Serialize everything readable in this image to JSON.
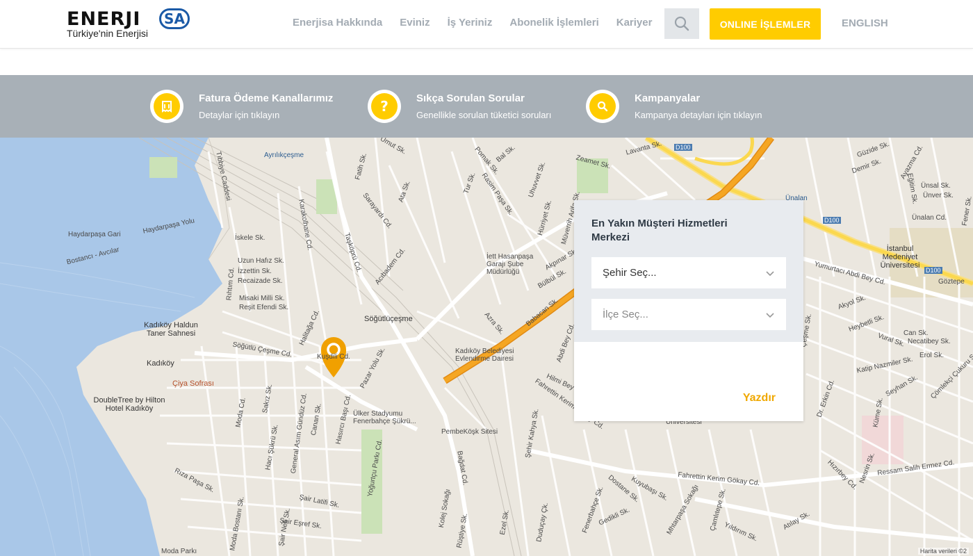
{
  "header": {
    "logo_word": "ENERJI",
    "logo_badge": "SA",
    "logo_tagline": "Türkiye'nin Enerjisi",
    "nav": [
      "Enerjisa Hakkında",
      "Eviniz",
      "İş Yeriniz",
      "Abonelik İşlemleri",
      "Kariyer"
    ],
    "online_label": "ONLINE İŞLEMLER",
    "lang_label": "ENGLISH"
  },
  "band": {
    "items": [
      {
        "icon": "invoice-icon",
        "title": "Fatura Ödeme Kanallarımız",
        "sub": "Detaylar için tıklayın"
      },
      {
        "icon": "question-icon",
        "title": "Sıkça Sorulan Sorular",
        "sub": "Genellikle sorulan tüketici soruları"
      },
      {
        "icon": "search-icon",
        "title": "Kampanyalar",
        "sub": "Kampanya detayları için tıklayın"
      }
    ]
  },
  "panel": {
    "title": "En Yakın Müşteri Hizmetleri Merkezi",
    "city_placeholder": "Şehir Seç...",
    "district_placeholder": "İlçe Seç...",
    "print_label": "Yazdır"
  },
  "map": {
    "labels": [
      "Ayrılıkçeşme",
      "Haydarpaşa Gari",
      "Haydarpaşa Yolu",
      "Bostancı - Avcılar",
      "Tıbbiye Caddesi",
      "İskele Sk.",
      "Uzun Hafız Sk.",
      "İzzettin Sk.",
      "Recaizade Sk.",
      "Misaki Milli Sk.",
      "Reşit Efendi Sk.",
      "Kadıköy Haldun Taner Sahnesi",
      "Kadıköy",
      "Çiya Sofrası",
      "DoubleTree by Hilton Hotel Kadıköy",
      "Söğütlü Çeşme Cd.",
      "Söğütlüçeşme",
      "Sarayardı Cd.",
      "Acıbadem Cd.",
      "Taşköprü Cd.",
      "İett Hasanpaşa Garajı Şube Müdürlüğü",
      "Kadıköy Belediyesi Evlendirme Dairesi",
      "Ülker Stadyumu Fenerbahçe Şükrü...",
      "PembeKöşk Sitesi",
      "Bağdat Cd.",
      "Yoğurtçu Parkı Cd.",
      "Moda Parkı",
      "Zeamet Sk.",
      "Lavanta Sk.",
      "Ünalan",
      "Ünalan Cd.",
      "İstanbul Medeniyet Üniversitesi",
      "Göztepe",
      "Yumurtacı Abdi Bey Cd.",
      "Fahrettin Kerim Gökay Cd.",
      "Ressam Salih Ermez Cd.",
      "Akyol Sk.",
      "Heybetli Sk.",
      "Vural Sk.",
      "Necatibey Sk.",
      "Erol Sk.",
      "Katip Nazmiler Sk.",
      "Seyhan Sk.",
      "Çömlekçi Çukuru Sokağı",
      "Güzide Sk.",
      "Demir Sk.",
      "Ayazma Cd.",
      "Ünsal Sk.",
      "Ünver Sk.",
      "Eğitim Sk.",
      "Üniversitesi",
      "Babacan Sk.",
      "Abdi Bey Cd.",
      "Hilmi Bey Sk.",
      "Azra Sk.",
      "Akpınar Sk.",
      "Bülbül Sk.",
      "Hürriyet Sk.",
      "Müverrih Arifa Sk.",
      "Uhuvvet Sk.",
      "Pomak Sk.",
      "Bal Sk.",
      "Tur Sk.",
      "Rasim Paşa Sk.",
      "Umut Sk.",
      "Ata Sk.",
      "Fatih Sk.",
      "Rıhtım Cd.",
      "Karakolhane Cd.",
      "Halitağa Cd.",
      "Kuşdili Cd.",
      "Pazar Yolu Sk.",
      "Hasırcı Başı Cd.",
      "Moda Cd.",
      "Sakız Sk.",
      "Hacı Şükrü Sk.",
      "General Asım Gündüz Cd.",
      "Canan Sk.",
      "Rıza Paşa Sk.",
      "Şair Latifi Sk.",
      "Şair Nefi Sk.",
      "Şair Eşref Sk.",
      "Moda Bostanı Sk.",
      "Kolej Sokağı",
      "Rüştiye Sk.",
      "Ezel Sk.",
      "Duduçay Çk.",
      "Fenerbahçe Sk.",
      "Dostane Sk.",
      "Gedikli Sk.",
      "Kuyubaşı Sk.",
      "Mhtarpaşa Sokağı",
      "Çamlıtepe Sk.",
      "Yıldırım Sk.",
      "Atılay Sk.",
      "Nesrin Sk.",
      "Hızırbey Cd.",
      "Küme Sk.",
      "Dr. Erkin Cd.",
      "Şehir Kahya Sk.",
      "Fahrettin Kerim Gökay Cd.",
      "Çeşme Sk.",
      "Can Sk.",
      "Fener Sk.",
      "D100"
    ],
    "attribution": "Harita verileri ©2"
  },
  "colors": {
    "accent": "#ffcc00",
    "band": "#a8b0b7",
    "sea": "#a9c7e8",
    "land": "#ebe7df",
    "highway": "#f5a623"
  }
}
